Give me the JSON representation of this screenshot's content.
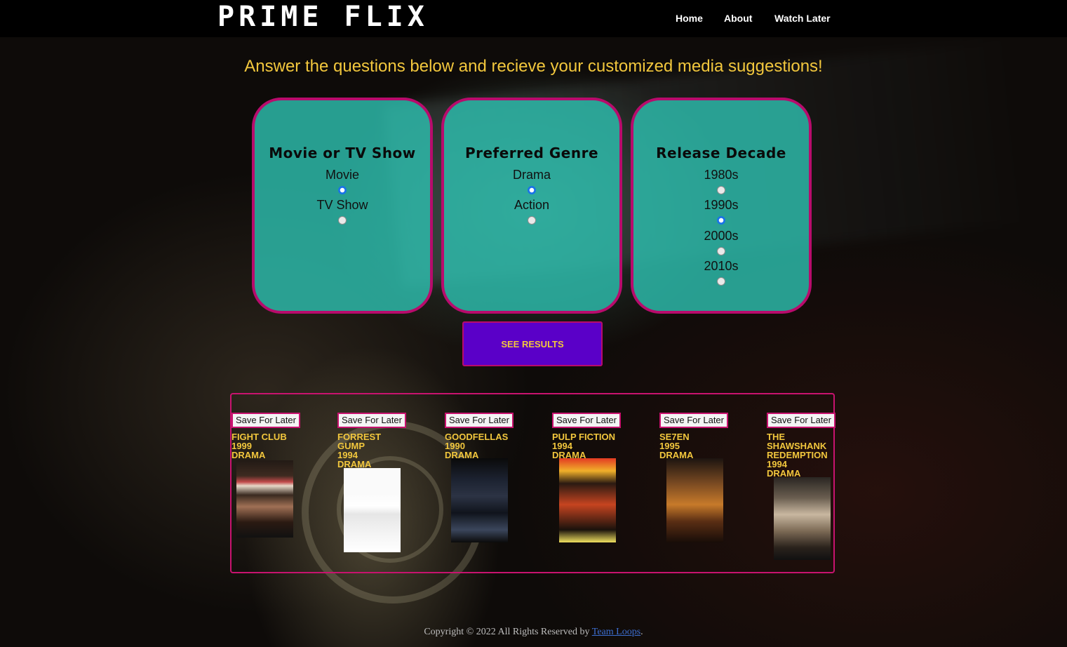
{
  "header": {
    "brand": "PRIME FLIX",
    "nav": [
      "Home",
      "About",
      "Watch Later"
    ]
  },
  "headline": "Answer the questions below and recieve your customized media suggestions!",
  "questions": [
    {
      "title": "Movie or TV Show",
      "options": [
        {
          "label": "Movie",
          "selected": true
        },
        {
          "label": "TV Show",
          "selected": false
        }
      ]
    },
    {
      "title": "Preferred Genre",
      "options": [
        {
          "label": "Drama",
          "selected": true
        },
        {
          "label": "Action",
          "selected": false
        }
      ]
    },
    {
      "title": "Release Decade",
      "options": [
        {
          "label": "1980s",
          "selected": false
        },
        {
          "label": "1990s",
          "selected": true
        },
        {
          "label": "2000s",
          "selected": false
        },
        {
          "label": "2010s",
          "selected": false
        }
      ]
    }
  ],
  "see_results_label": "SEE RESULTS",
  "results": {
    "save_label": "Save For Later",
    "movies": [
      {
        "title": "FIGHT CLUB",
        "year": "1999",
        "genre": "DRAMA"
      },
      {
        "title": "FORREST GUMP",
        "year": "1994",
        "genre": "DRAMA"
      },
      {
        "title": "GOODFELLAS",
        "year": "1990",
        "genre": "DRAMA"
      },
      {
        "title": "PULP FICTION",
        "year": "1994",
        "genre": "DRAMA"
      },
      {
        "title": "SE7EN",
        "year": "1995",
        "genre": "DRAMA"
      },
      {
        "title": "THE SHAWSHANK REDEMPTION",
        "year": "1994",
        "genre": "DRAMA"
      }
    ]
  },
  "footer": {
    "text": "Copyright © 2022 All Rights Reserved by ",
    "link": "Team Loops",
    "end": "."
  },
  "colors": {
    "accent": "#b80b6c",
    "card": "#2dbeaf",
    "gold": "#f2c73d",
    "button": "#5a00c8"
  }
}
